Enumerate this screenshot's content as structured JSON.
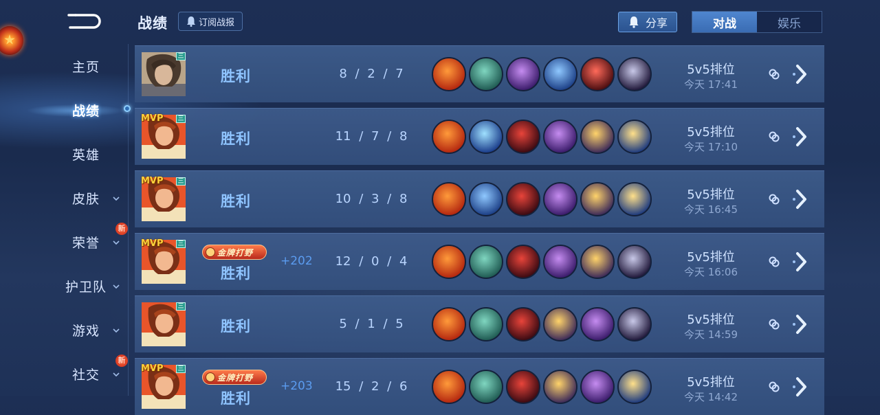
{
  "header": {
    "title": "战绩",
    "subscribe_label": "订阅战报",
    "share_label": "分享",
    "tabs": [
      {
        "label": "对战",
        "active": true
      },
      {
        "label": "娱乐",
        "active": false
      }
    ]
  },
  "sidebar": {
    "items": [
      {
        "label": "主页",
        "active": false,
        "has_chevron": false,
        "new": false
      },
      {
        "label": "战绩",
        "active": true,
        "has_chevron": false,
        "new": false
      },
      {
        "label": "英雄",
        "active": false,
        "has_chevron": false,
        "new": false
      },
      {
        "label": "皮肤",
        "active": false,
        "has_chevron": true,
        "new": false
      },
      {
        "label": "荣誉",
        "active": false,
        "has_chevron": true,
        "new": true
      },
      {
        "label": "护卫队",
        "active": false,
        "has_chevron": true,
        "new": false
      },
      {
        "label": "游戏",
        "active": false,
        "has_chevron": true,
        "new": false
      },
      {
        "label": "社交",
        "active": false,
        "has_chevron": true,
        "new": true
      }
    ],
    "new_badge_text": "新"
  },
  "matches": [
    {
      "result": "胜利",
      "mvp": false,
      "rank_badge": "三",
      "title_badge": "",
      "score_delta": "",
      "kda": "8 / 2 / 7",
      "mode": "5v5排位",
      "time": "今天 17:41",
      "avatar": "hero-a",
      "items": [
        "orange-blade",
        "green-boots",
        "purple-axe",
        "blue-spear",
        "red-blade",
        "dark-spear"
      ]
    },
    {
      "result": "胜利",
      "mvp": true,
      "rank_badge": "三",
      "title_badge": "",
      "score_delta": "",
      "kda": "11 / 7 / 8",
      "mode": "5v5排位",
      "time": "今天 17:10",
      "avatar": "hero-b",
      "items": [
        "orange-blade",
        "blue-armor",
        "red-wing",
        "purple-axe",
        "gold-net",
        "blue-gold-spear"
      ]
    },
    {
      "result": "胜利",
      "mvp": true,
      "rank_badge": "三",
      "title_badge": "",
      "score_delta": "",
      "kda": "10 / 3 / 8",
      "mode": "5v5排位",
      "time": "今天 16:45",
      "avatar": "hero-b",
      "items": [
        "orange-blade",
        "blue-spear",
        "red-wing",
        "purple-axe",
        "gold-net",
        "blue-gold-spear"
      ]
    },
    {
      "result": "胜利",
      "mvp": true,
      "rank_badge": "三",
      "title_badge": "金牌打野",
      "score_delta": "+202",
      "kda": "12 / 0 / 4",
      "mode": "5v5排位",
      "time": "今天 16:06",
      "avatar": "hero-b",
      "items": [
        "orange-blade",
        "green-boots",
        "red-wing",
        "purple-axe",
        "gold-net",
        "dark-spear"
      ]
    },
    {
      "result": "胜利",
      "mvp": false,
      "rank_badge": "三",
      "title_badge": "",
      "score_delta": "",
      "kda": "5 / 1 / 5",
      "mode": "5v5排位",
      "time": "今天 14:59",
      "avatar": "hero-b",
      "items": [
        "orange-blade",
        "green-boots",
        "red-wing",
        "gold-net",
        "purple-axe",
        "dark-spear"
      ]
    },
    {
      "result": "胜利",
      "mvp": true,
      "rank_badge": "三",
      "title_badge": "金牌打野",
      "score_delta": "+203",
      "kda": "15 / 2 / 6",
      "mode": "5v5排位",
      "time": "今天 14:42",
      "avatar": "hero-b",
      "items": [
        "orange-blade",
        "green-boots",
        "red-wing",
        "gold-net",
        "purple-axe",
        "blue-gold-spear"
      ]
    }
  ],
  "mvp_text": "MVP",
  "item_colors": {
    "orange-blade": [
      "#ff9a3a",
      "#b3260f"
    ],
    "green-boots": [
      "#7fd6c0",
      "#1f5a52"
    ],
    "purple-axe": [
      "#c58cf0",
      "#3a1b6a"
    ],
    "blue-spear": [
      "#8fc8ff",
      "#1c3f86"
    ],
    "red-blade": [
      "#ff6a5a",
      "#4a0d10"
    ],
    "dark-spear": [
      "#c8c8e8",
      "#20183a"
    ],
    "blue-armor": [
      "#9fe0ff",
      "#1a3c8a"
    ],
    "red-wing": [
      "#e8443a",
      "#3a0a12"
    ],
    "gold-net": [
      "#ffd36a",
      "#3d2a58"
    ],
    "blue-gold-spear": [
      "#ffe08a",
      "#1d3a7e"
    ]
  }
}
